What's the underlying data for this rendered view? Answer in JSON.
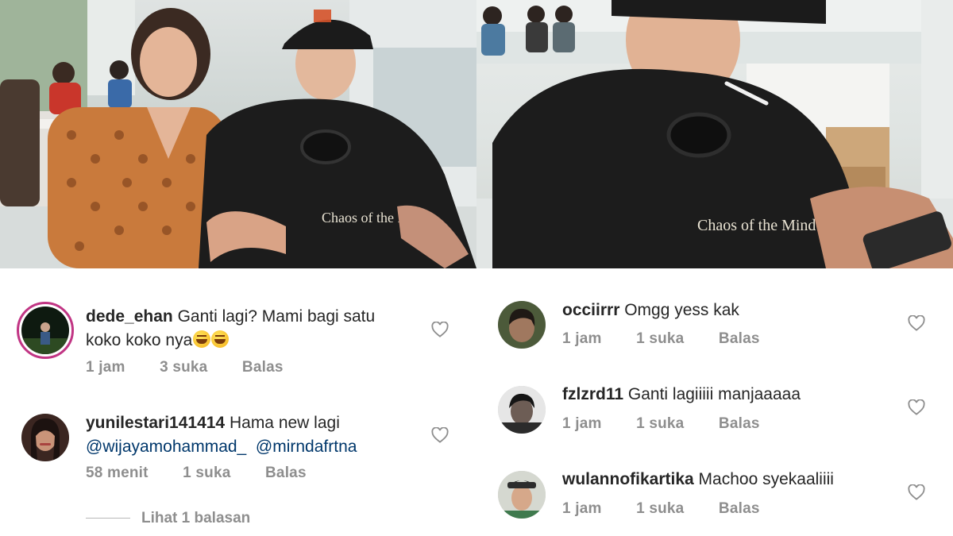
{
  "left_comments": [
    {
      "username": "dede_ehan",
      "text_line1": "Ganti lagi? Mami bagi satu",
      "text_line2": "koko koko nya",
      "time": "1 jam",
      "likes": "3 suka",
      "reply": "Balas",
      "has_story_ring": true
    },
    {
      "username": "yunilestari141414",
      "text_line1": "Hama new lagi",
      "mention1": "@wijayamohammad_",
      "mention2": "@mirndafrtna",
      "time": "58 menit",
      "likes": "1 suka",
      "reply": "Balas",
      "view_replies": "Lihat 1 balasan"
    }
  ],
  "right_comments": [
    {
      "username": "occiirrr",
      "text": "Omgg yess kak",
      "time": "1 jam",
      "likes": "1 suka",
      "reply": "Balas"
    },
    {
      "username": "fzlzrd11",
      "text": "Ganti lagiiiii manjaaaaa",
      "time": "1 jam",
      "likes": "1 suka",
      "reply": "Balas"
    },
    {
      "username": "wulannofikartika",
      "text": "Machoo syekaaliiii",
      "time": "1 jam",
      "likes": "1 suka",
      "reply": "Balas"
    }
  ],
  "photos": {
    "left_shirt_text": "Chaos of the Mind",
    "right_shirt_text": "Chaos of the Mind"
  },
  "colors": {
    "text": "#262626",
    "meta": "#8e8e8e",
    "mention": "#00376b",
    "story_ring": "#c13584"
  },
  "icons": {
    "like": "heart-outline-icon"
  }
}
